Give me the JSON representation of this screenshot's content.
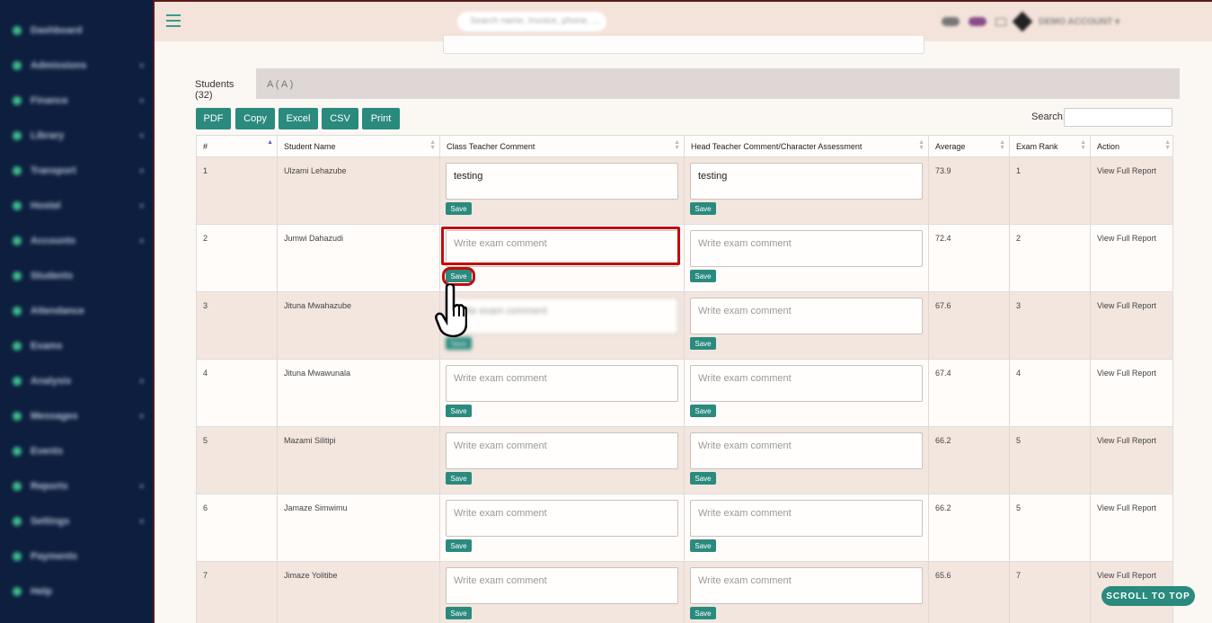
{
  "sidebar": {
    "items": [
      {
        "label": "Dashboard",
        "caret": false
      },
      {
        "label": "Admissions",
        "caret": true
      },
      {
        "label": "Finance",
        "caret": true
      },
      {
        "label": "Library",
        "caret": true
      },
      {
        "label": "Transport",
        "caret": true
      },
      {
        "label": "Hostel",
        "caret": true
      },
      {
        "label": "Accounts",
        "caret": true
      },
      {
        "label": "Students",
        "caret": false
      },
      {
        "label": "Attendance",
        "caret": false
      },
      {
        "label": "Exams",
        "caret": false
      },
      {
        "label": "Analysis",
        "caret": true
      },
      {
        "label": "Messages",
        "caret": true
      },
      {
        "label": "Events",
        "caret": false
      },
      {
        "label": "Reports",
        "caret": true
      },
      {
        "label": "Settings",
        "caret": true
      },
      {
        "label": "Payments",
        "caret": false
      },
      {
        "label": "Help",
        "caret": false
      }
    ]
  },
  "topbar": {
    "search_placeholder": "Search name, Invoice, phone, ...",
    "account": "DEMO ACCOUNT ▾"
  },
  "tabs": [
    {
      "label": "Students (32)",
      "active": true
    },
    {
      "label": "A ( A )",
      "active": false
    }
  ],
  "toolbar": {
    "buttons": [
      "PDF",
      "Copy",
      "Excel",
      "CSV",
      "Print"
    ],
    "search_label": "Search:"
  },
  "table": {
    "headers": [
      "#",
      "Student Name",
      "Class Teacher Comment",
      "Head Teacher Comment/Character Assessment",
      "Average",
      "Exam Rank",
      "Action"
    ],
    "placeholder": "Write exam comment",
    "save_label": "Save",
    "action_label": "View Full Report",
    "rows": [
      {
        "num": "1",
        "name": "Ulzami Lehazube",
        "class_comment": "testing",
        "head_comment": "testing",
        "average": "73.9",
        "rank": "1"
      },
      {
        "num": "2",
        "name": "Jumwi Dahazudi",
        "class_comment": "",
        "head_comment": "",
        "average": "72.4",
        "rank": "2"
      },
      {
        "num": "3",
        "name": "Jituna Mwahazube",
        "class_comment": "",
        "head_comment": "",
        "average": "67.6",
        "rank": "3"
      },
      {
        "num": "4",
        "name": "Jituna Mwawunala",
        "class_comment": "",
        "head_comment": "",
        "average": "67.4",
        "rank": "4"
      },
      {
        "num": "5",
        "name": "Mazami Silitipi",
        "class_comment": "",
        "head_comment": "",
        "average": "66.2",
        "rank": "5"
      },
      {
        "num": "6",
        "name": "Jamaze Simwimu",
        "class_comment": "",
        "head_comment": "",
        "average": "66.2",
        "rank": "5"
      },
      {
        "num": "7",
        "name": "Jimaze Yolitibe",
        "class_comment": "",
        "head_comment": "",
        "average": "65.6",
        "rank": "7"
      }
    ]
  },
  "scroll_top_label": "SCROLL TO TOP",
  "colors": {
    "accent": "#2a8a7e",
    "sidebar": "#0d1e3f",
    "highlight": "#c40a0a"
  }
}
